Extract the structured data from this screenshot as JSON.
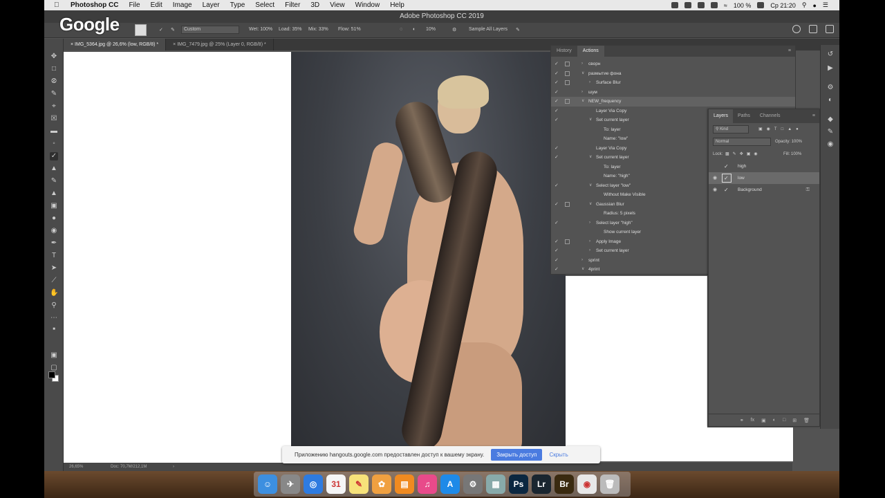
{
  "menubar": {
    "app_name": "Photoshop CC",
    "items": [
      "File",
      "Edit",
      "Image",
      "Layer",
      "Type",
      "Select",
      "Filter",
      "3D",
      "View",
      "Window",
      "Help"
    ],
    "battery": "100 %",
    "clock": "Ср 21:20"
  },
  "window": {
    "title": "Adobe Photoshop CC 2019"
  },
  "overlay": {
    "logo_text": "Google"
  },
  "options": {
    "preset": "Custom",
    "wet": "Wet: 100%",
    "load": "Load: 35%",
    "mix": "Mix: 33%",
    "flow": "Flow: 51%",
    "angle": "10%",
    "sample": "Sample All Layers"
  },
  "tabs": [
    {
      "label": "IMG_5364.jpg @ 26,6% (low, RGB/8) *",
      "active": true
    },
    {
      "label": "IMG_7479.jpg @ 25% (Layer 0, RGB/8) *",
      "active": false
    }
  ],
  "actions_panel": {
    "tabs": [
      "History",
      "Actions"
    ],
    "rows": [
      {
        "label": "сворн",
        "indent": 1,
        "checked": true,
        "dialog": true,
        "expand": "collapsed"
      },
      {
        "label": "размытие фона",
        "indent": 1,
        "checked": true,
        "dialog": true,
        "expand": "expanded"
      },
      {
        "label": "Surface Blur",
        "indent": 2,
        "checked": true,
        "dialog": true,
        "expand": "collapsed"
      },
      {
        "label": "шум",
        "indent": 1,
        "checked": true,
        "dialog": false,
        "expand": "collapsed"
      },
      {
        "label": "NEW_frequency",
        "indent": 1,
        "checked": true,
        "dialog": true,
        "expand": "expanded",
        "selected": true
      },
      {
        "label": "Layer Via Copy",
        "indent": 2,
        "checked": true,
        "dialog": false,
        "expand": "none"
      },
      {
        "label": "Set current layer",
        "indent": 2,
        "checked": true,
        "dialog": false,
        "expand": "expanded"
      },
      {
        "label": "To: layer",
        "indent": 3,
        "checked": false,
        "dialog": false,
        "expand": "none"
      },
      {
        "label": "Name: \"low\"",
        "indent": 3,
        "checked": false,
        "dialog": false,
        "expand": "none"
      },
      {
        "label": "Layer Via Copy",
        "indent": 2,
        "checked": true,
        "dialog": false,
        "expand": "none"
      },
      {
        "label": "Set current layer",
        "indent": 2,
        "checked": true,
        "dialog": false,
        "expand": "expanded"
      },
      {
        "label": "To: layer",
        "indent": 3,
        "checked": false,
        "dialog": false,
        "expand": "none"
      },
      {
        "label": "Name: \"high\"",
        "indent": 3,
        "checked": false,
        "dialog": false,
        "expand": "none"
      },
      {
        "label": "Select layer \"low\"",
        "indent": 2,
        "checked": true,
        "dialog": false,
        "expand": "expanded"
      },
      {
        "label": "Without Make Visible",
        "indent": 3,
        "checked": false,
        "dialog": false,
        "expand": "none"
      },
      {
        "label": "Gaussian Blur",
        "indent": 2,
        "checked": true,
        "dialog": true,
        "expand": "expanded"
      },
      {
        "label": "Radius: 5 pixels",
        "indent": 3,
        "checked": false,
        "dialog": false,
        "expand": "none"
      },
      {
        "label": "Select layer \"high\"",
        "indent": 2,
        "checked": true,
        "dialog": false,
        "expand": "collapsed"
      },
      {
        "label": "Show current layer",
        "indent": 3,
        "checked": false,
        "dialog": false,
        "expand": "none"
      },
      {
        "label": "Apply Image",
        "indent": 2,
        "checked": true,
        "dialog": true,
        "expand": "collapsed"
      },
      {
        "label": "Set current layer",
        "indent": 2,
        "checked": true,
        "dialog": false,
        "expand": "collapsed"
      },
      {
        "label": "sprint",
        "indent": 1,
        "checked": true,
        "dialog": false,
        "expand": "collapsed"
      },
      {
        "label": "4print",
        "indent": 1,
        "checked": true,
        "dialog": false,
        "expand": "expanded"
      }
    ]
  },
  "layers_panel": {
    "tabs": [
      "Layers",
      "Paths",
      "Channels"
    ],
    "kind_label": "Kind",
    "blend_mode": "Normal",
    "opacity": "Opacity: 100%",
    "lock_label": "Lock:",
    "fill": "Fill: 100%",
    "layers": [
      {
        "name": "high",
        "visible": false,
        "selected": false,
        "locked": false
      },
      {
        "name": "low",
        "visible": true,
        "selected": true,
        "locked": false
      },
      {
        "name": "Background",
        "visible": true,
        "selected": false,
        "locked": true
      }
    ]
  },
  "sharebar": {
    "message": "Приложению hangouts.google.com предоставлен доступ к вашему экрану.",
    "stop_label": "Закрыть доступ",
    "hide_label": "Скрыть"
  },
  "status": {
    "zoom": "26,65%",
    "doc": "Doc: 70,7M/212,1M"
  },
  "dock": {
    "apps": [
      {
        "name": "finder-icon",
        "glyph": "☺",
        "color": "#3d8fe0"
      },
      {
        "name": "launchpad-icon",
        "glyph": "✈",
        "color": "#888"
      },
      {
        "name": "safari-icon",
        "glyph": "◎",
        "color": "#2e7be0"
      },
      {
        "name": "calendar-icon",
        "glyph": "31",
        "color": "#f5f5f5"
      },
      {
        "name": "notes-icon",
        "glyph": "✎",
        "color": "#f7e27a"
      },
      {
        "name": "photos-icon",
        "glyph": "✿",
        "color": "#f0a040"
      },
      {
        "name": "books-icon",
        "glyph": "▤",
        "color": "#f08a20"
      },
      {
        "name": "itunes-icon",
        "glyph": "♫",
        "color": "#e84a8a"
      },
      {
        "name": "appstore-icon",
        "glyph": "A",
        "color": "#1e8ae8"
      },
      {
        "name": "system-preferences-icon",
        "glyph": "⚙",
        "color": "#777"
      },
      {
        "name": "preview-icon",
        "glyph": "▦",
        "color": "#8aa"
      },
      {
        "name": "photoshop-icon",
        "glyph": "Ps",
        "color": "#0b2740"
      },
      {
        "name": "lightroom-icon",
        "glyph": "Lr",
        "color": "#1a2630"
      },
      {
        "name": "bridge-icon",
        "glyph": "Br",
        "color": "#3a2a10"
      },
      {
        "name": "chrome-icon",
        "glyph": "◉",
        "color": "#e8e8e8"
      },
      {
        "name": "trash-icon",
        "glyph": "🗑",
        "color": "#bbb"
      }
    ]
  }
}
